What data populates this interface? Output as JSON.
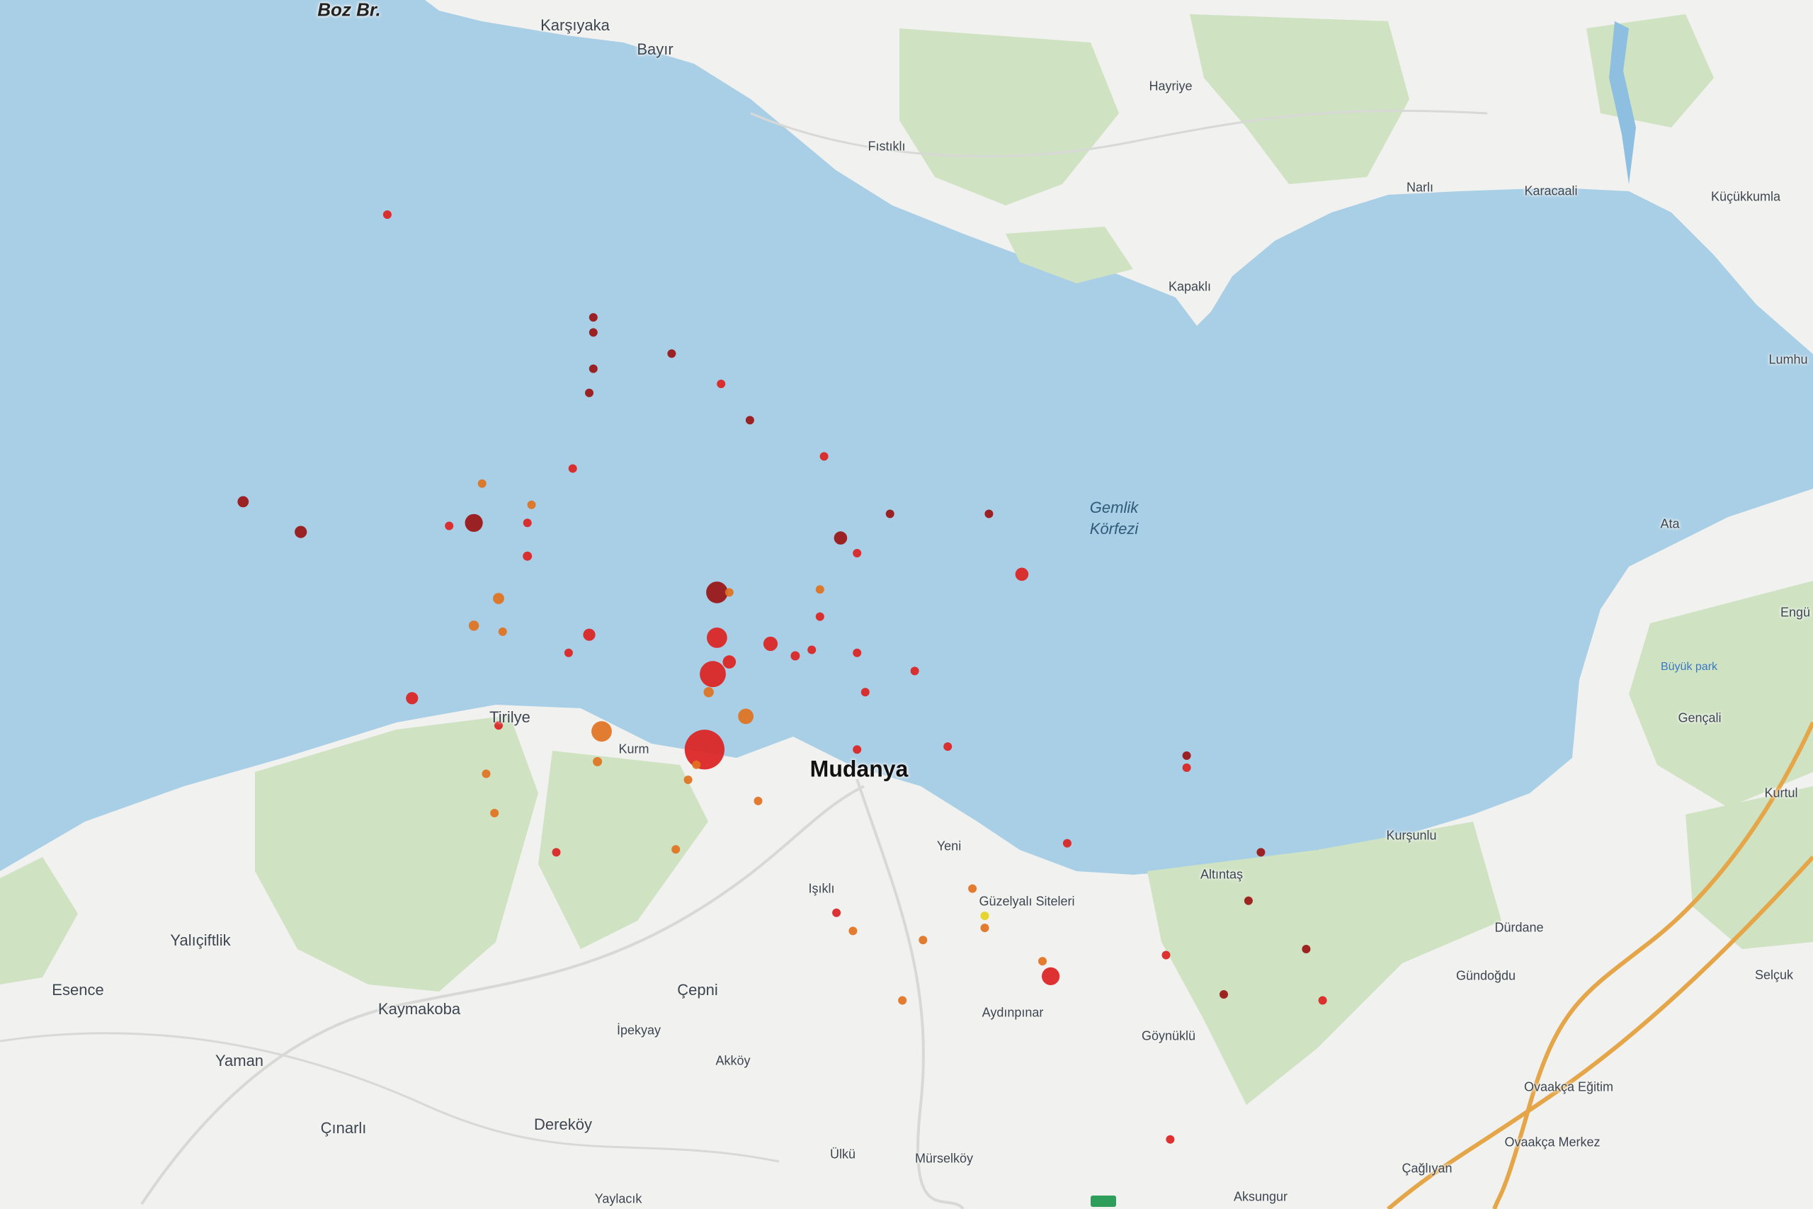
{
  "map": {
    "water_label": {
      "line1": "Gemlik",
      "line2": "Körfezi"
    },
    "places": {
      "boz_br": "Boz Br.",
      "karsiyaka": "Karşıyaka",
      "bayir": "Bayır",
      "fistikli": "Fıstıklı",
      "hayriye": "Hayriye",
      "narli": "Narlı",
      "karacaali": "Karacaali",
      "kucukkumla": "Küçükkumla",
      "kapakli": "Kapaklı",
      "lumhu": "Lumhu",
      "ata": "Ata",
      "engu": "Engü",
      "buyuk_park": "Büyük park",
      "gencali": "Gençali",
      "kurtul": "Kurtul",
      "tirilye": "Tirilye",
      "kurm": "Kurm",
      "mudanya": "Mudanya",
      "yeni": "Yeni",
      "isikli": "Işıklı",
      "guzelyali": "Güzelyalı Siteleri",
      "altintas": "Altıntaş",
      "kursunlu": "Kurşunlu",
      "dürdane": "Dürdane",
      "selcuk": "Selçuk",
      "gundogdu": "Gündoğdu",
      "yalicitlik": "Yalıçiftlik",
      "esence": "Esence",
      "kaymakoba": "Kaymakoba",
      "cepni": "Çepni",
      "ipekyay": "İpekyay",
      "akkoy": "Akköy",
      "aydinpinar": "Aydınpınar",
      "goynuklu": "Göynüklü",
      "yaman": "Yaman",
      "cinarli": "Çınarlı",
      "derekoy": "Dereköy",
      "ulku": "Ülkü",
      "murselkoy": "Mürselköy",
      "yaylacik": "Yaylacık",
      "aksungur": "Aksungur",
      "cagriyan": "Çağlıyan",
      "ovaakca_egitim": "Ovaakça Eğitim",
      "ovaakca_merkez": "Ovaakça Merkez"
    }
  },
  "colors": {
    "sea": "#a9cfe6",
    "land": "#f1f1ef",
    "forest": "#cfe3c2",
    "road": "#e5a64a",
    "quake_deep_red": "#9a1414",
    "quake_red": "#dc2222",
    "quake_orange": "#e0721f",
    "quake_yellow": "#e6d21e"
  },
  "earthquakes": [
    {
      "lon": 28.871,
      "lat": 40.552,
      "mag": 4.4,
      "color": "red"
    },
    {
      "lon": 28.873,
      "lat": 40.577,
      "mag": 3.6,
      "color": "red"
    },
    {
      "lon": 28.874,
      "lat": 40.589,
      "mag": 3.2,
      "color": "red"
    },
    {
      "lon": 28.846,
      "lat": 40.558,
      "mag": 3.2,
      "color": "orange"
    },
    {
      "lon": 28.874,
      "lat": 40.604,
      "mag": 3.3,
      "color": "deep"
    },
    {
      "lon": 28.815,
      "lat": 40.627,
      "mag": 3.0,
      "color": "deep"
    },
    {
      "lon": 28.881,
      "lat": 40.563,
      "mag": 2.8,
      "color": "orange"
    },
    {
      "lon": 28.887,
      "lat": 40.587,
      "mag": 2.7,
      "color": "red"
    },
    {
      "lon": 28.877,
      "lat": 40.581,
      "mag": 2.6,
      "color": "red"
    },
    {
      "lon": 28.843,
      "lat": 40.59,
      "mag": 2.5,
      "color": "red"
    },
    {
      "lon": 28.821,
      "lat": 40.602,
      "mag": 2.4,
      "color": "orange"
    },
    {
      "lon": 28.8,
      "lat": 40.569,
      "mag": 2.5,
      "color": "red"
    },
    {
      "lon": 28.904,
      "lat": 40.622,
      "mag": 2.6,
      "color": "deep"
    },
    {
      "lon": 28.948,
      "lat": 40.61,
      "mag": 2.6,
      "color": "red"
    },
    {
      "lon": 28.955,
      "lat": 40.477,
      "mag": 3.0,
      "color": "red"
    },
    {
      "lon": 28.773,
      "lat": 40.624,
      "mag": 2.5,
      "color": "deep"
    },
    {
      "lon": 28.759,
      "lat": 40.634,
      "mag": 2.4,
      "color": "deep"
    },
    {
      "lon": 28.815,
      "lat": 40.593,
      "mag": 2.3,
      "color": "orange"
    },
    {
      "lon": 28.872,
      "lat": 40.571,
      "mag": 2.3,
      "color": "orange"
    },
    {
      "lon": 28.893,
      "lat": 40.583,
      "mag": 2.2,
      "color": "red"
    },
    {
      "lon": 28.908,
      "lat": 40.584,
      "mag": 2.1,
      "color": "red"
    },
    {
      "lon": 28.899,
      "lat": 40.596,
      "mag": 2.0,
      "color": "red"
    },
    {
      "lon": 28.838,
      "lat": 40.584,
      "mag": 2.0,
      "color": "red"
    },
    {
      "lon": 28.821,
      "lat": 40.56,
      "mag": 2.0,
      "color": "red"
    },
    {
      "lon": 28.845,
      "lat": 40.548,
      "mag": 2.2,
      "color": "orange"
    },
    {
      "lon": 28.867,
      "lat": 40.542,
      "mag": 2.0,
      "color": "orange"
    },
    {
      "lon": 28.877,
      "lat": 40.604,
      "mag": 2.0,
      "color": "orange"
    },
    {
      "lon": 28.829,
      "lat": 40.633,
      "mag": 2.1,
      "color": "orange"
    },
    {
      "lon": 28.809,
      "lat": 40.626,
      "mag": 2.0,
      "color": "red"
    },
    {
      "lon": 28.828,
      "lat": 40.616,
      "mag": 2.2,
      "color": "red"
    },
    {
      "lon": 28.839,
      "lat": 40.645,
      "mag": 2.1,
      "color": "red"
    },
    {
      "lon": 28.843,
      "lat": 40.67,
      "mag": 2.0,
      "color": "deep"
    },
    {
      "lon": 28.844,
      "lat": 40.678,
      "mag": 2.0,
      "color": "deep"
    },
    {
      "lon": 28.882,
      "lat": 40.661,
      "mag": 2.0,
      "color": "deep"
    },
    {
      "lon": 28.9,
      "lat": 40.649,
      "mag": 2.0,
      "color": "red"
    },
    {
      "lon": 28.916,
      "lat": 40.63,
      "mag": 2.0,
      "color": "deep"
    },
    {
      "lon": 28.94,
      "lat": 40.63,
      "mag": 2.0,
      "color": "deep"
    },
    {
      "lon": 28.908,
      "lat": 40.617,
      "mag": 2.0,
      "color": "red"
    },
    {
      "lon": 28.899,
      "lat": 40.605,
      "mag": 2.0,
      "color": "orange"
    },
    {
      "lon": 28.897,
      "lat": 40.585,
      "mag": 2.0,
      "color": "red"
    },
    {
      "lon": 28.91,
      "lat": 40.571,
      "mag": 2.0,
      "color": "red"
    },
    {
      "lon": 28.922,
      "lat": 40.578,
      "mag": 2.0,
      "color": "red"
    },
    {
      "lon": 28.908,
      "lat": 40.552,
      "mag": 2.0,
      "color": "red"
    },
    {
      "lon": 28.93,
      "lat": 40.553,
      "mag": 2.0,
      "color": "red"
    },
    {
      "lon": 28.869,
      "lat": 40.547,
      "mag": 2.0,
      "color": "orange"
    },
    {
      "lon": 28.818,
      "lat": 40.544,
      "mag": 2.0,
      "color": "orange"
    },
    {
      "lon": 28.828,
      "lat": 40.627,
      "mag": 2.0,
      "color": "red"
    },
    {
      "lon": 28.817,
      "lat": 40.64,
      "mag": 2.0,
      "color": "orange"
    },
    {
      "lon": 28.822,
      "lat": 40.591,
      "mag": 2.0,
      "color": "orange"
    },
    {
      "lon": 28.884,
      "lat": 40.535,
      "mag": 2.0,
      "color": "orange"
    },
    {
      "lon": 28.82,
      "lat": 40.531,
      "mag": 2.0,
      "color": "orange"
    },
    {
      "lon": 28.835,
      "lat": 40.518,
      "mag": 2.0,
      "color": "red"
    },
    {
      "lon": 28.864,
      "lat": 40.519,
      "mag": 2.0,
      "color": "orange"
    },
    {
      "lon": 28.959,
      "lat": 40.521,
      "mag": 2.0,
      "color": "red"
    },
    {
      "lon": 28.988,
      "lat": 40.55,
      "mag": 2.0,
      "color": "deep"
    },
    {
      "lon": 28.988,
      "lat": 40.546,
      "mag": 2.0,
      "color": "red"
    },
    {
      "lon": 29.006,
      "lat": 40.518,
      "mag": 2.0,
      "color": "deep"
    },
    {
      "lon": 29.003,
      "lat": 40.502,
      "mag": 2.0,
      "color": "deep"
    },
    {
      "lon": 28.936,
      "lat": 40.506,
      "mag": 2.0,
      "color": "orange"
    },
    {
      "lon": 28.939,
      "lat": 40.497,
      "mag": 2.0,
      "color": "yellow"
    },
    {
      "lon": 28.939,
      "lat": 40.493,
      "mag": 2.0,
      "color": "orange"
    },
    {
      "lon": 28.903,
      "lat": 40.498,
      "mag": 2.0,
      "color": "red"
    },
    {
      "lon": 28.907,
      "lat": 40.492,
      "mag": 2.0,
      "color": "orange"
    },
    {
      "lon": 28.924,
      "lat": 40.489,
      "mag": 2.0,
      "color": "orange"
    },
    {
      "lon": 28.953,
      "lat": 40.482,
      "mag": 2.0,
      "color": "orange"
    },
    {
      "lon": 28.983,
      "lat": 40.484,
      "mag": 2.0,
      "color": "red"
    },
    {
      "lon": 29.017,
      "lat": 40.486,
      "mag": 2.0,
      "color": "deep"
    },
    {
      "lon": 28.919,
      "lat": 40.469,
      "mag": 2.0,
      "color": "orange"
    },
    {
      "lon": 28.997,
      "lat": 40.471,
      "mag": 2.0,
      "color": "deep"
    },
    {
      "lon": 29.021,
      "lat": 40.469,
      "mag": 2.0,
      "color": "red"
    },
    {
      "lon": 28.794,
      "lat": 40.729,
      "mag": 2.0,
      "color": "red"
    },
    {
      "lon": 28.844,
      "lat": 40.695,
      "mag": 2.0,
      "color": "deep"
    },
    {
      "lon": 28.844,
      "lat": 40.69,
      "mag": 2.0,
      "color": "deep"
    },
    {
      "lon": 28.863,
      "lat": 40.683,
      "mag": 2.0,
      "color": "deep"
    },
    {
      "lon": 28.875,
      "lat": 40.673,
      "mag": 2.0,
      "color": "red"
    },
    {
      "lon": 28.984,
      "lat": 40.423,
      "mag": 2.0,
      "color": "red"
    }
  ]
}
